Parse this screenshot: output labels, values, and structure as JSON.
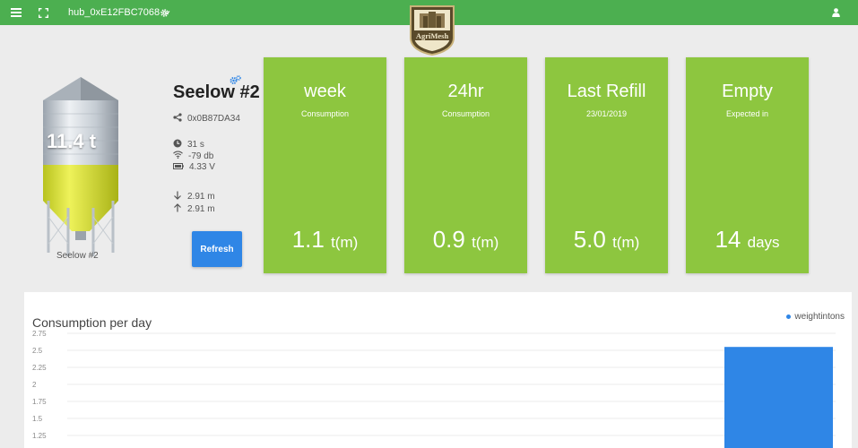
{
  "topbar": {
    "hub_label": "hub_0xE12FBC7068",
    "brand_logo_text": "AgriMesh"
  },
  "device": {
    "name": "Seelow #2",
    "weight": "11.4 t",
    "caption": "Seelow #2",
    "id": "0x0B87DA34",
    "last_seen": "31 s",
    "signal": "-79 db",
    "battery": "4.33 V",
    "distance_down": "2.91 m",
    "distance_up": "2.91 m",
    "refresh_label": "Refresh"
  },
  "cards": [
    {
      "title": "week",
      "subtitle": "Consumption",
      "value": "1.1",
      "unit": "t(m)"
    },
    {
      "title": "24hr",
      "subtitle": "Consumption",
      "value": "0.9",
      "unit": "t(m)"
    },
    {
      "title": "Last Refill",
      "subtitle": "23/01/2019",
      "value": "5.0",
      "unit": "t(m)"
    },
    {
      "title": "Empty",
      "subtitle": "Expected in",
      "value": "14",
      "unit": "days"
    }
  ],
  "colors": {
    "topbar": "#4caf50",
    "card": "#8dc63f",
    "accent_blue": "#2f86e6"
  },
  "chart_data": {
    "type": "bar",
    "title": "Consumption per day",
    "ylim": [
      1.25,
      2.75
    ],
    "yticks": [
      "2.75",
      "2.5",
      "2.25",
      "2",
      "1.75",
      "1.5",
      "1.25"
    ],
    "series": [
      {
        "name": "weightintons",
        "values": [
          2.55
        ]
      }
    ],
    "grid": true,
    "legend": "top-right"
  }
}
